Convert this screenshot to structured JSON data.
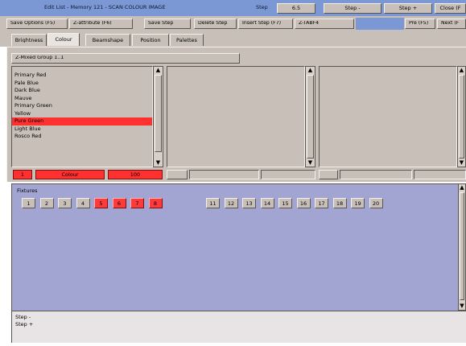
{
  "title_bar": {
    "title": "Edit List - Memory 121 - SCAN COLOUR IMAGE",
    "step_label": "Step",
    "step_value": "6.5",
    "step_minus": "Step -",
    "step_plus": "Step +",
    "close": "Close (F"
  },
  "toolbar": {
    "buttons": [
      "Save Options (F5)",
      "Z-attribute (F6)",
      "Save Step",
      "Delete Step",
      "Insert Step (F7)",
      "Z-TABF4"
    ],
    "right_buttons": [
      "Pre (F5)",
      "Next (F"
    ]
  },
  "tabs": [
    "Brightness",
    "Colour",
    "Beamshape",
    "Position",
    "Palettes"
  ],
  "group_title": "Z-Mixed Group 1..1",
  "list1": {
    "items": [
      "Primary Red",
      "Pale Blue",
      "Dark Blue",
      "Mauve",
      "Primary Green",
      "Yellow",
      "Pure Green",
      "Light Blue",
      "Rosco Red"
    ],
    "selected_index": 6
  },
  "bottom_bar": {
    "num": "1",
    "col": "Colour",
    "val": "100"
  },
  "fixtures": {
    "title": "Fixtures",
    "group1": [
      {
        "label": "1",
        "on": false
      },
      {
        "label": "2",
        "on": false
      },
      {
        "label": "3",
        "on": false
      },
      {
        "label": "4",
        "on": false
      },
      {
        "label": "5",
        "on": true
      },
      {
        "label": "6",
        "on": true
      },
      {
        "label": "7",
        "on": true
      },
      {
        "label": "8",
        "on": true
      }
    ],
    "group2": [
      {
        "label": "11",
        "on": false
      },
      {
        "label": "12",
        "on": false
      },
      {
        "label": "13",
        "on": false
      },
      {
        "label": "14",
        "on": false
      },
      {
        "label": "15",
        "on": false
      },
      {
        "label": "16",
        "on": false
      },
      {
        "label": "17",
        "on": false
      },
      {
        "label": "18",
        "on": false
      },
      {
        "label": "19",
        "on": false
      },
      {
        "label": "20",
        "on": false
      }
    ]
  },
  "status": {
    "line1": "Step -",
    "line2": "Step +"
  },
  "colors": {
    "title_bar": "#6a8ccc",
    "panel_grey": "#c8c0b8",
    "fixtures_bg": "#9fa2cc",
    "selected_red": "#ff3030"
  }
}
